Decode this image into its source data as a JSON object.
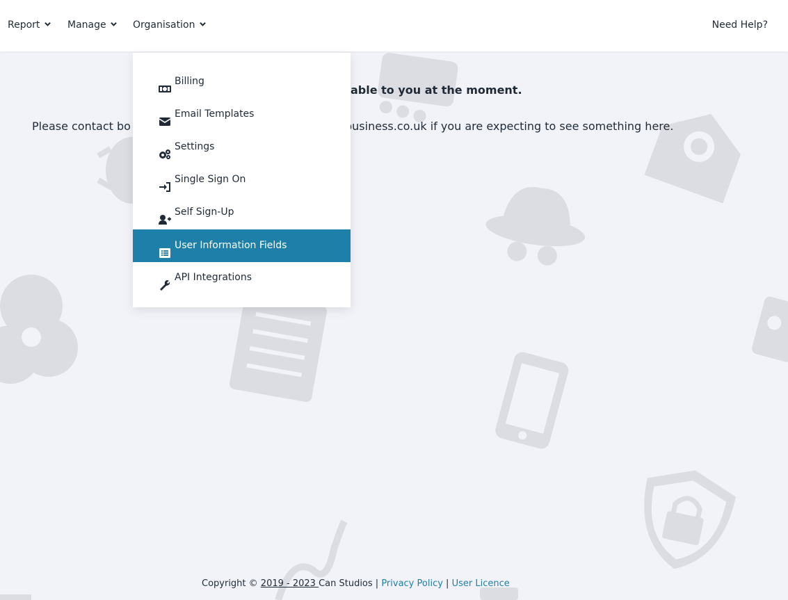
{
  "nav": {
    "report_label": "Report",
    "manage_label": "Manage",
    "organisation_label": "Organisation",
    "help_label": "Need Help?"
  },
  "main": {
    "notice_visible": "able to you at the moment.",
    "contact_prefix": "Please contact bo",
    "contact_suffix": "business.co.uk if you are expecting to see something here."
  },
  "dropdown": {
    "items": [
      {
        "label": "Billing",
        "icon": "money-bill-icon"
      },
      {
        "label": "Email Templates",
        "icon": "envelope-icon"
      },
      {
        "label": "Settings",
        "icon": "cogs-icon"
      },
      {
        "label": "Single Sign On",
        "icon": "sign-in-icon"
      },
      {
        "label": "Self Sign-Up",
        "icon": "user-plus-icon"
      },
      {
        "label": "User Information Fields",
        "icon": "list-alt-icon",
        "active": true
      },
      {
        "label": "API Integrations",
        "icon": "wrench-icon"
      }
    ]
  },
  "footer": {
    "copyright_prefix": "Copyright © ",
    "years": "2019 - 2023 ",
    "company": "Can Studios",
    "sep": " | ",
    "privacy_label": "Privacy Policy",
    "licence_label": "User Licence"
  },
  "colors": {
    "accent": "#1e7fa8",
    "background": "#f2f3f8",
    "watermark": "#dcdde3",
    "text": "#1f2a36"
  }
}
